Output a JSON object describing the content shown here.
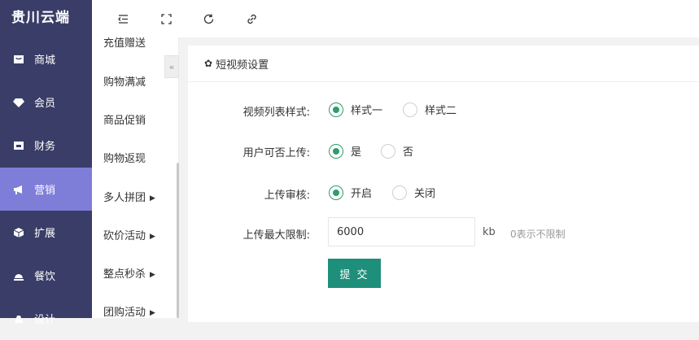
{
  "brand": {
    "title": "贵川云端"
  },
  "sidebar": {
    "items": [
      {
        "label": "商城",
        "icon": "shop-icon"
      },
      {
        "label": "会员",
        "icon": "diamond-icon"
      },
      {
        "label": "财务",
        "icon": "wallet-icon"
      },
      {
        "label": "营销",
        "icon": "megaphone-icon",
        "active": true
      },
      {
        "label": "扩展",
        "icon": "cube-icon"
      },
      {
        "label": "餐饮",
        "icon": "dining-bell-icon"
      },
      {
        "label": "设计",
        "icon": "design-icon"
      }
    ]
  },
  "toolbar": {
    "icons": [
      "menu-indent-icon",
      "fullscreen-icon",
      "refresh-icon",
      "link-icon"
    ]
  },
  "submenu": {
    "items": [
      {
        "label": "充值赠送"
      },
      {
        "label": "购物满减"
      },
      {
        "label": "商品促销"
      },
      {
        "label": "购物返现"
      },
      {
        "label": "多人拼团",
        "arrow": "▶"
      },
      {
        "label": "砍价活动",
        "arrow": "▶"
      },
      {
        "label": "整点秒杀",
        "arrow": "▶"
      },
      {
        "label": "团购活动",
        "arrow": "▶"
      }
    ],
    "collapse_glyph": "«"
  },
  "panel": {
    "title": "短视频设置",
    "gear_glyph": "✿"
  },
  "form": {
    "list_style": {
      "label": "视频列表样式:",
      "options": [
        "样式一",
        "样式二"
      ],
      "selected": 0
    },
    "user_upload": {
      "label": "用户可否上传:",
      "options": [
        "是",
        "否"
      ],
      "selected": 0
    },
    "upload_review": {
      "label": "上传审核:",
      "options": [
        "开启",
        "关闭"
      ],
      "selected": 0
    },
    "max_upload": {
      "label": "上传最大限制:",
      "value": "6000",
      "unit": "kb",
      "hint": "0表示不限制"
    },
    "submit_label": "提 交"
  },
  "colors": {
    "sidebar": "#393d67",
    "active": "#7e7dd7",
    "accent": "#2e9d6c",
    "button": "#1e8f7a"
  }
}
